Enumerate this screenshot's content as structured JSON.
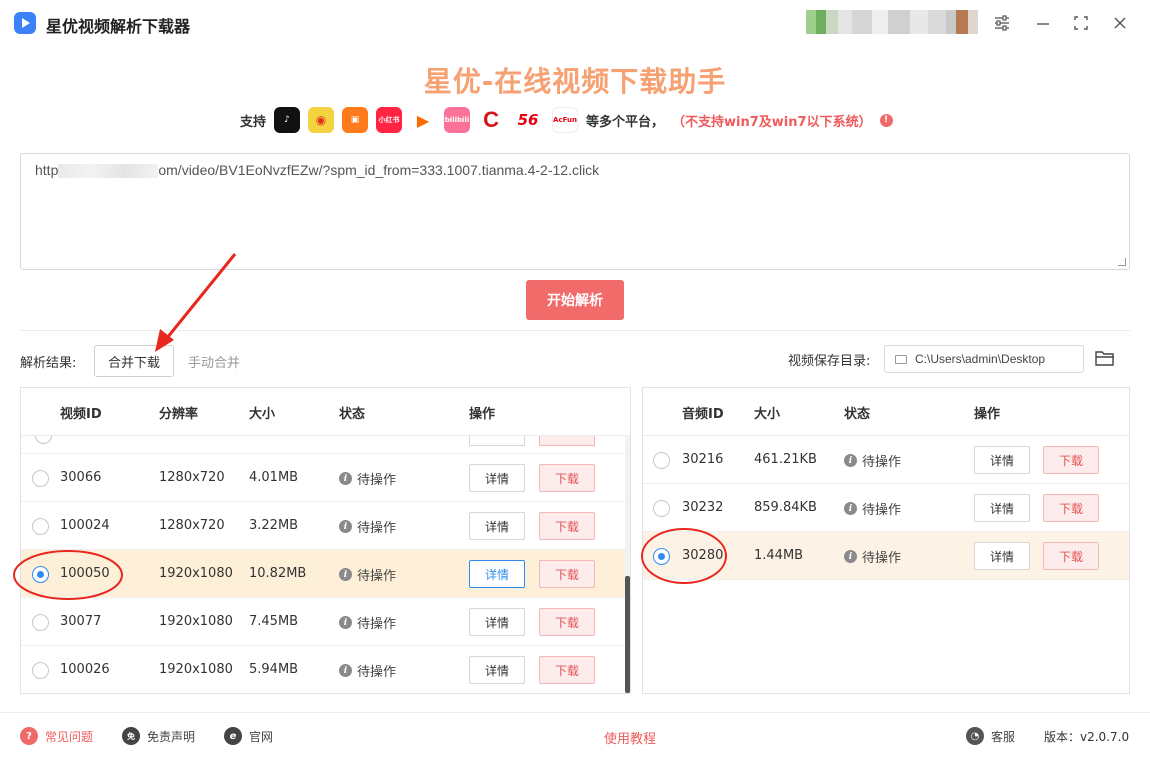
{
  "app": {
    "title": "星优视频解析下载器"
  },
  "window": {
    "settings_icon": "sliders-icon",
    "minimize_icon": "minimize-icon",
    "maximize_icon": "maximize-icon",
    "close_icon": "close-icon"
  },
  "header": {
    "headline": "星优-在线视频下载助手",
    "support_label": "支持",
    "platforms": [
      "tiktok",
      "weibo",
      "kuaishou",
      "xiaohongshu",
      "tencent-video",
      "bilibili",
      "cctv",
      "56",
      "acfun"
    ],
    "platform_texts": {
      "xiaohongshu": "小红书",
      "bilibili": "bilibili",
      "n56": "56",
      "acfun": "AcFun"
    },
    "more_label": "等多个平台，",
    "warning": "（不支持win7及win7以下系统）"
  },
  "url_input": {
    "value_prefix": "http",
    "value_suffix": "om/video/BV1EoNvzfEZw/?spm_id_from=333.1007.tianma.4-2-12.click"
  },
  "parse_button": "开始解析",
  "results": {
    "label": "解析结果:",
    "merge_download": "合并下载",
    "manual_merge": "手动合并",
    "save_dir_label": "视频保存目录:",
    "save_dir": "C:\\Users\\admin\\Desktop"
  },
  "video_table": {
    "headers": [
      "视频ID",
      "分辨率",
      "大小",
      "状态",
      "操作"
    ],
    "rows": [
      {
        "id": "30066",
        "resolution": "1280x720",
        "size": "4.01MB",
        "status": "待操作",
        "selected": false
      },
      {
        "id": "100024",
        "resolution": "1280x720",
        "size": "3.22MB",
        "status": "待操作",
        "selected": false
      },
      {
        "id": "100050",
        "resolution": "1920x1080",
        "size": "10.82MB",
        "status": "待操作",
        "selected": true
      },
      {
        "id": "30077",
        "resolution": "1920x1080",
        "size": "7.45MB",
        "status": "待操作",
        "selected": false
      },
      {
        "id": "100026",
        "resolution": "1920x1080",
        "size": "5.94MB",
        "status": "待操作",
        "selected": false
      }
    ],
    "detail_label": "详情",
    "download_label": "下载"
  },
  "audio_table": {
    "headers": [
      "音频ID",
      "大小",
      "状态",
      "操作"
    ],
    "rows": [
      {
        "id": "30216",
        "size": "461.21KB",
        "status": "待操作",
        "selected": false
      },
      {
        "id": "30232",
        "size": "859.84KB",
        "status": "待操作",
        "selected": false
      },
      {
        "id": "30280",
        "size": "1.44MB",
        "status": "待操作",
        "selected": true
      }
    ],
    "detail_label": "详情",
    "download_label": "下载"
  },
  "footer": {
    "faq": "常见问题",
    "disclaimer": "免责声明",
    "website": "官网",
    "tutorial": "使用教程",
    "service": "客服",
    "version": "版本：v2.0.7.0"
  },
  "colors": {
    "accent": "#f26b6b",
    "headline": "#f7a072",
    "selected_row": "#fef0d8",
    "radio_on": "#2f8cf0"
  }
}
